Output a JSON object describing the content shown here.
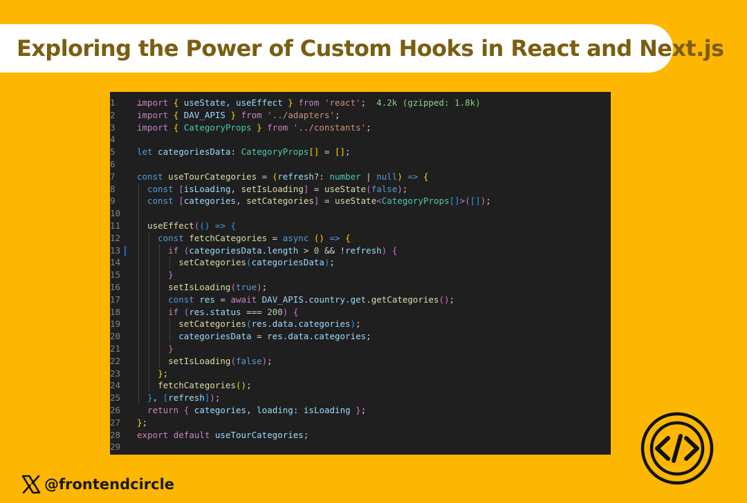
{
  "header": {
    "title": "Exploring the Power of Custom Hooks in React and Next.js"
  },
  "editor": {
    "top_partial_text": "…",
    "lines": [
      {
        "n": "1",
        "tokens": [
          [
            "import",
            "kw"
          ],
          [
            " ",
            "pun"
          ],
          [
            "{",
            "br1"
          ],
          [
            " useState, useEffect ",
            "var"
          ],
          [
            "}",
            "br1"
          ],
          [
            " from ",
            "kw"
          ],
          [
            "'react'",
            "str"
          ],
          [
            ";",
            "pun"
          ],
          [
            "  4.2k (gzipped: 1.8k)",
            "hint"
          ]
        ]
      },
      {
        "n": "2",
        "tokens": [
          [
            "import",
            "kw"
          ],
          [
            " ",
            "pun"
          ],
          [
            "{",
            "br1"
          ],
          [
            " DAV_APIS ",
            "var"
          ],
          [
            "}",
            "br1"
          ],
          [
            " from ",
            "kw"
          ],
          [
            "'../adapters'",
            "str"
          ],
          [
            ";",
            "pun"
          ]
        ]
      },
      {
        "n": "3",
        "tokens": [
          [
            "import",
            "kw"
          ],
          [
            " ",
            "pun"
          ],
          [
            "{",
            "br1"
          ],
          [
            " CategoryProps ",
            "ty"
          ],
          [
            "}",
            "br1"
          ],
          [
            " from ",
            "kw"
          ],
          [
            "'../constants'",
            "str"
          ],
          [
            ";",
            "pun"
          ]
        ]
      },
      {
        "n": "4",
        "tokens": []
      },
      {
        "n": "5",
        "tokens": [
          [
            "let",
            "st"
          ],
          [
            " categoriesData",
            "var"
          ],
          [
            ": ",
            "pun"
          ],
          [
            "CategoryProps",
            "ty"
          ],
          [
            "[]",
            "br1"
          ],
          [
            " = ",
            "pun"
          ],
          [
            "[]",
            "br1"
          ],
          [
            ";",
            "pun"
          ]
        ]
      },
      {
        "n": "6",
        "tokens": []
      },
      {
        "n": "7",
        "tokens": [
          [
            "const",
            "st"
          ],
          [
            " useTourCategories",
            "fn"
          ],
          [
            " = ",
            "pun"
          ],
          [
            "(",
            "br1"
          ],
          [
            "refresh",
            "var"
          ],
          [
            "?: ",
            "pun"
          ],
          [
            "number",
            "ty"
          ],
          [
            " | ",
            "pun"
          ],
          [
            "null",
            "st"
          ],
          [
            ")",
            "br1"
          ],
          [
            " => ",
            "st"
          ],
          [
            "{",
            "br1"
          ]
        ]
      },
      {
        "n": "8",
        "tokens": [
          [
            "  const",
            "st"
          ],
          [
            " ",
            "pun"
          ],
          [
            "[",
            "br2"
          ],
          [
            "isLoading",
            "var"
          ],
          [
            ", ",
            "pun"
          ],
          [
            "setIsLoading",
            "fn"
          ],
          [
            "]",
            "br2"
          ],
          [
            " = ",
            "pun"
          ],
          [
            "useState",
            "fn"
          ],
          [
            "(",
            "br2"
          ],
          [
            "false",
            "st"
          ],
          [
            ")",
            "br2"
          ],
          [
            ";",
            "pun"
          ]
        ]
      },
      {
        "n": "9",
        "tokens": [
          [
            "  const",
            "st"
          ],
          [
            " ",
            "pun"
          ],
          [
            "[",
            "br2"
          ],
          [
            "categories",
            "var"
          ],
          [
            ", ",
            "pun"
          ],
          [
            "setCategories",
            "fn"
          ],
          [
            "]",
            "br2"
          ],
          [
            " = ",
            "pun"
          ],
          [
            "useState",
            "fn"
          ],
          [
            "<",
            "br2"
          ],
          [
            "CategoryProps",
            "ty"
          ],
          [
            "[]",
            "br3"
          ],
          [
            ">",
            "br2"
          ],
          [
            "(",
            "br2"
          ],
          [
            "[]",
            "br3"
          ],
          [
            ")",
            "br2"
          ],
          [
            ";",
            "pun"
          ]
        ]
      },
      {
        "n": "10",
        "tokens": []
      },
      {
        "n": "11",
        "tokens": [
          [
            "  useEffect",
            "fn"
          ],
          [
            "(",
            "br2"
          ],
          [
            "()",
            "br3"
          ],
          [
            " => ",
            "st"
          ],
          [
            "{",
            "br3"
          ]
        ]
      },
      {
        "n": "12",
        "tokens": [
          [
            "    const",
            "st"
          ],
          [
            " fetchCategories",
            "fn"
          ],
          [
            " = ",
            "pun"
          ],
          [
            "async",
            "st"
          ],
          [
            " ",
            "pun"
          ],
          [
            "()",
            "br1"
          ],
          [
            " => ",
            "st"
          ],
          [
            "{",
            "br1"
          ]
        ]
      },
      {
        "n": "13",
        "tokens": [
          [
            "      if",
            "kw"
          ],
          [
            " ",
            "pun"
          ],
          [
            "(",
            "br2"
          ],
          [
            "categoriesData",
            "var"
          ],
          [
            ".",
            "pun"
          ],
          [
            "length",
            "var"
          ],
          [
            " > ",
            "pun"
          ],
          [
            "0",
            "num"
          ],
          [
            " && !",
            "pun"
          ],
          [
            "refresh",
            "var"
          ],
          [
            ")",
            "br2"
          ],
          [
            " ",
            "pun"
          ],
          [
            "{",
            "br2"
          ]
        ]
      },
      {
        "n": "14",
        "tokens": [
          [
            "        setCategories",
            "fn"
          ],
          [
            "(",
            "br3"
          ],
          [
            "categoriesData",
            "var"
          ],
          [
            ")",
            "br3"
          ],
          [
            ";",
            "pun"
          ]
        ]
      },
      {
        "n": "15",
        "tokens": [
          [
            "      }",
            "br2"
          ]
        ]
      },
      {
        "n": "16",
        "tokens": [
          [
            "      setIsLoading",
            "fn"
          ],
          [
            "(",
            "br2"
          ],
          [
            "true",
            "st"
          ],
          [
            ")",
            "br2"
          ],
          [
            ";",
            "pun"
          ]
        ]
      },
      {
        "n": "17",
        "tokens": [
          [
            "      const",
            "st"
          ],
          [
            " res",
            "var"
          ],
          [
            " = ",
            "pun"
          ],
          [
            "await",
            "kw"
          ],
          [
            " DAV_APIS",
            "var"
          ],
          [
            ".",
            "pun"
          ],
          [
            "country",
            "var"
          ],
          [
            ".",
            "pun"
          ],
          [
            "get",
            "var"
          ],
          [
            ".",
            "pun"
          ],
          [
            "getCategories",
            "fn"
          ],
          [
            "()",
            "br2"
          ],
          [
            ";",
            "pun"
          ]
        ]
      },
      {
        "n": "18",
        "tokens": [
          [
            "      if",
            "kw"
          ],
          [
            " ",
            "pun"
          ],
          [
            "(",
            "br2"
          ],
          [
            "res",
            "var"
          ],
          [
            ".",
            "pun"
          ],
          [
            "status",
            "var"
          ],
          [
            " === ",
            "pun"
          ],
          [
            "200",
            "num"
          ],
          [
            ")",
            "br2"
          ],
          [
            " ",
            "pun"
          ],
          [
            "{",
            "br2"
          ]
        ]
      },
      {
        "n": "19",
        "tokens": [
          [
            "        setCategories",
            "fn"
          ],
          [
            "(",
            "br3"
          ],
          [
            "res",
            "var"
          ],
          [
            ".",
            "pun"
          ],
          [
            "data",
            "var"
          ],
          [
            ".",
            "pun"
          ],
          [
            "categories",
            "var"
          ],
          [
            ")",
            "br3"
          ],
          [
            ";",
            "pun"
          ]
        ]
      },
      {
        "n": "20",
        "tokens": [
          [
            "        categoriesData",
            "var"
          ],
          [
            " = ",
            "pun"
          ],
          [
            "res",
            "var"
          ],
          [
            ".",
            "pun"
          ],
          [
            "data",
            "var"
          ],
          [
            ".",
            "pun"
          ],
          [
            "categories",
            "var"
          ],
          [
            ";",
            "pun"
          ]
        ]
      },
      {
        "n": "21",
        "tokens": [
          [
            "      }",
            "br2"
          ]
        ]
      },
      {
        "n": "22",
        "tokens": [
          [
            "      setIsLoading",
            "fn"
          ],
          [
            "(",
            "br2"
          ],
          [
            "false",
            "st"
          ],
          [
            ")",
            "br2"
          ],
          [
            ";",
            "pun"
          ]
        ]
      },
      {
        "n": "23",
        "tokens": [
          [
            "    }",
            "br1"
          ],
          [
            ";",
            "pun"
          ]
        ]
      },
      {
        "n": "24",
        "tokens": [
          [
            "    fetchCategories",
            "fn"
          ],
          [
            "()",
            "br1"
          ],
          [
            ";",
            "pun"
          ]
        ]
      },
      {
        "n": "25",
        "tokens": [
          [
            "  }",
            "br3"
          ],
          [
            ", ",
            "pun"
          ],
          [
            "[",
            "br3"
          ],
          [
            "refresh",
            "var"
          ],
          [
            "]",
            "br3"
          ],
          [
            ")",
            "br2"
          ],
          [
            ";",
            "pun"
          ]
        ]
      },
      {
        "n": "26",
        "tokens": [
          [
            "  return",
            "kw"
          ],
          [
            " ",
            "pun"
          ],
          [
            "{",
            "br2"
          ],
          [
            " categories",
            "var"
          ],
          [
            ", ",
            "pun"
          ],
          [
            "loading",
            "var"
          ],
          [
            ": ",
            "pun"
          ],
          [
            "isLoading",
            "var"
          ],
          [
            " ",
            "pun"
          ],
          [
            "}",
            "br2"
          ],
          [
            ";",
            "pun"
          ]
        ]
      },
      {
        "n": "27",
        "tokens": [
          [
            "}",
            "br1"
          ],
          [
            ";",
            "pun"
          ]
        ]
      },
      {
        "n": "28",
        "tokens": [
          [
            "export",
            "kw"
          ],
          [
            " default ",
            "kw"
          ],
          [
            "useTourCategories",
            "var"
          ],
          [
            ";",
            "pun"
          ]
        ]
      },
      {
        "n": "29",
        "tokens": []
      }
    ]
  },
  "footer": {
    "handle": "@frontendcircle",
    "x_logo_icon": "x-logo-icon",
    "code_logo_icon": "code-brackets-icon"
  },
  "colors": {
    "background": "#FDB602",
    "title": "#7A5E10",
    "editor_bg": "#1F1F1F"
  }
}
